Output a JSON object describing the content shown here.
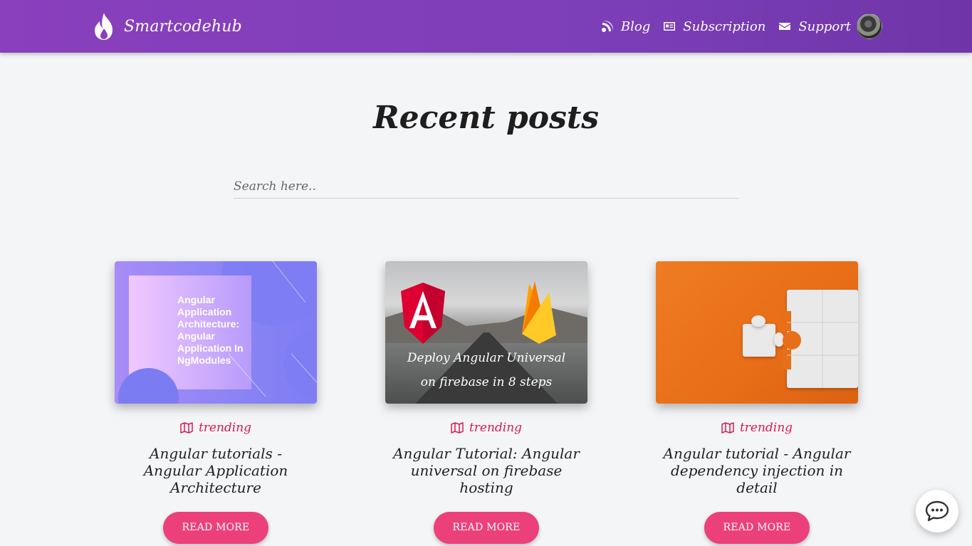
{
  "brand": {
    "name": "Smartcodehub",
    "logo_icon": "flame-icon"
  },
  "nav": {
    "items": [
      {
        "label": "Blog",
        "icon": "rss-icon"
      },
      {
        "label": "Subscription",
        "icon": "id-card-icon"
      },
      {
        "label": "Support",
        "icon": "envelope-icon"
      }
    ],
    "avatar": "user-avatar"
  },
  "main": {
    "title": "Recent posts",
    "search_placeholder": "Search here.."
  },
  "posts": [
    {
      "tag": "trending",
      "title": "Angular tutorials - Angular Application Architecture",
      "button": "READ MORE",
      "image_text": "Angular Application Architecture: Angular Application In NgModules"
    },
    {
      "tag": "trending",
      "title": "Angular Tutorial: Angular universal on firebase hosting",
      "button": "READ MORE",
      "image_caption_1": "Deploy Angular Universal",
      "image_caption_2": "on firebase in    8 steps"
    },
    {
      "tag": "trending",
      "title": "Angular tutorial - Angular dependency injection in detail",
      "button": "READ MORE"
    }
  ],
  "colors": {
    "navbar": "#8a3fbd",
    "tag": "#d81b50",
    "button": "#ec407a",
    "background": "#f4f5f7"
  },
  "chat_widget": {
    "icon": "chat-bubble-icon"
  }
}
